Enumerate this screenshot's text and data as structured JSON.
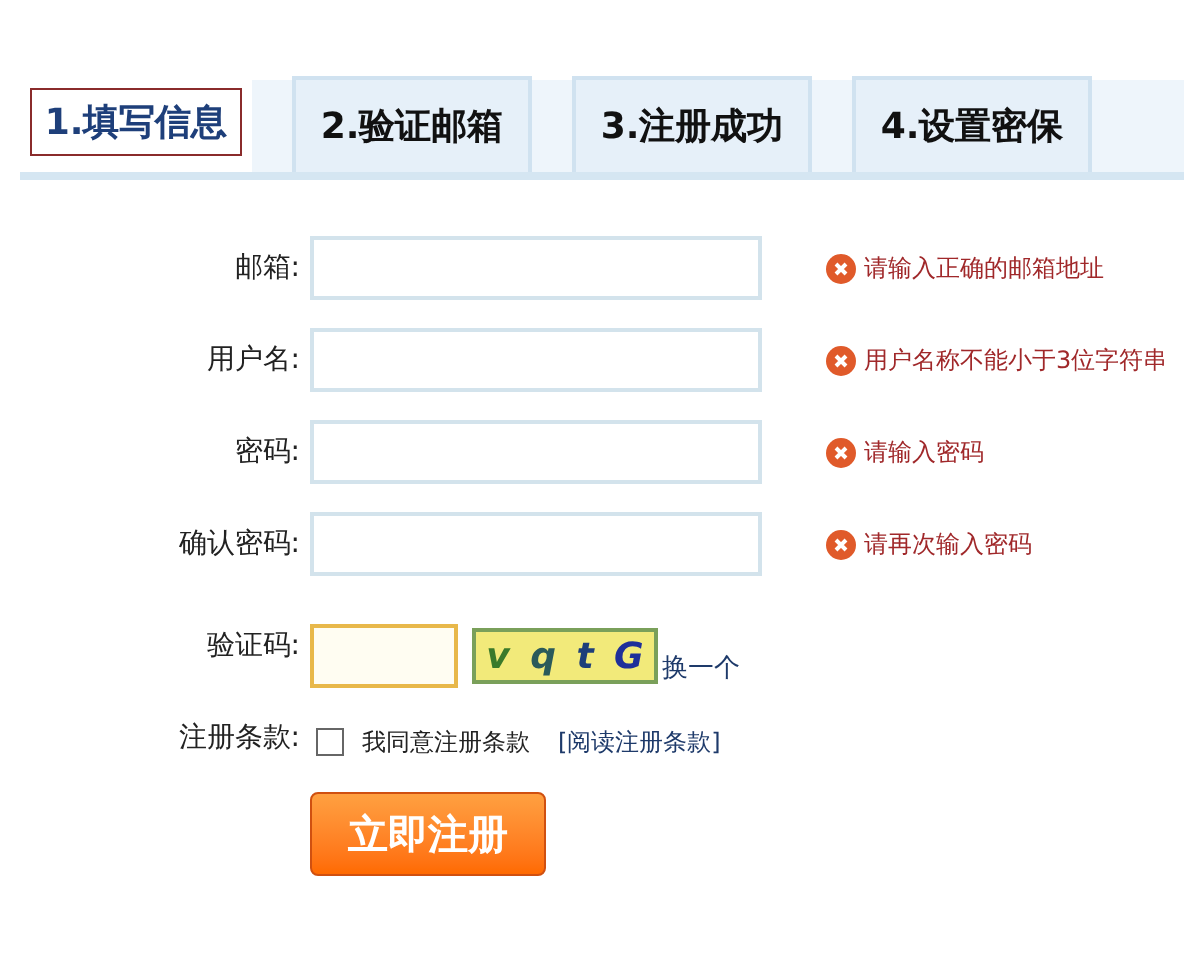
{
  "tabs": [
    {
      "label": "1.填写信息",
      "selected": true
    },
    {
      "label": "2.验证邮箱",
      "selected": false
    },
    {
      "label": "3.注册成功",
      "selected": false
    },
    {
      "label": "4.设置密保",
      "selected": false
    }
  ],
  "fields": [
    {
      "label": "邮箱:",
      "error": "请输入正确的邮箱地址"
    },
    {
      "label": "用户名:",
      "error": "用户名称不能小于3位字符串"
    },
    {
      "label": "密码:",
      "error": "请输入密码"
    },
    {
      "label": "确认密码:",
      "error": "请再次输入密码"
    }
  ],
  "captcha": {
    "label": "验证码:",
    "focused": true,
    "code": [
      "v",
      "q",
      "t",
      "G"
    ],
    "refresh": "换一个"
  },
  "terms": {
    "label": "注册条款:",
    "checkbox": "我同意注册条款",
    "checked": false,
    "link": "[阅读注册条款]"
  },
  "submit": "立即注册"
}
